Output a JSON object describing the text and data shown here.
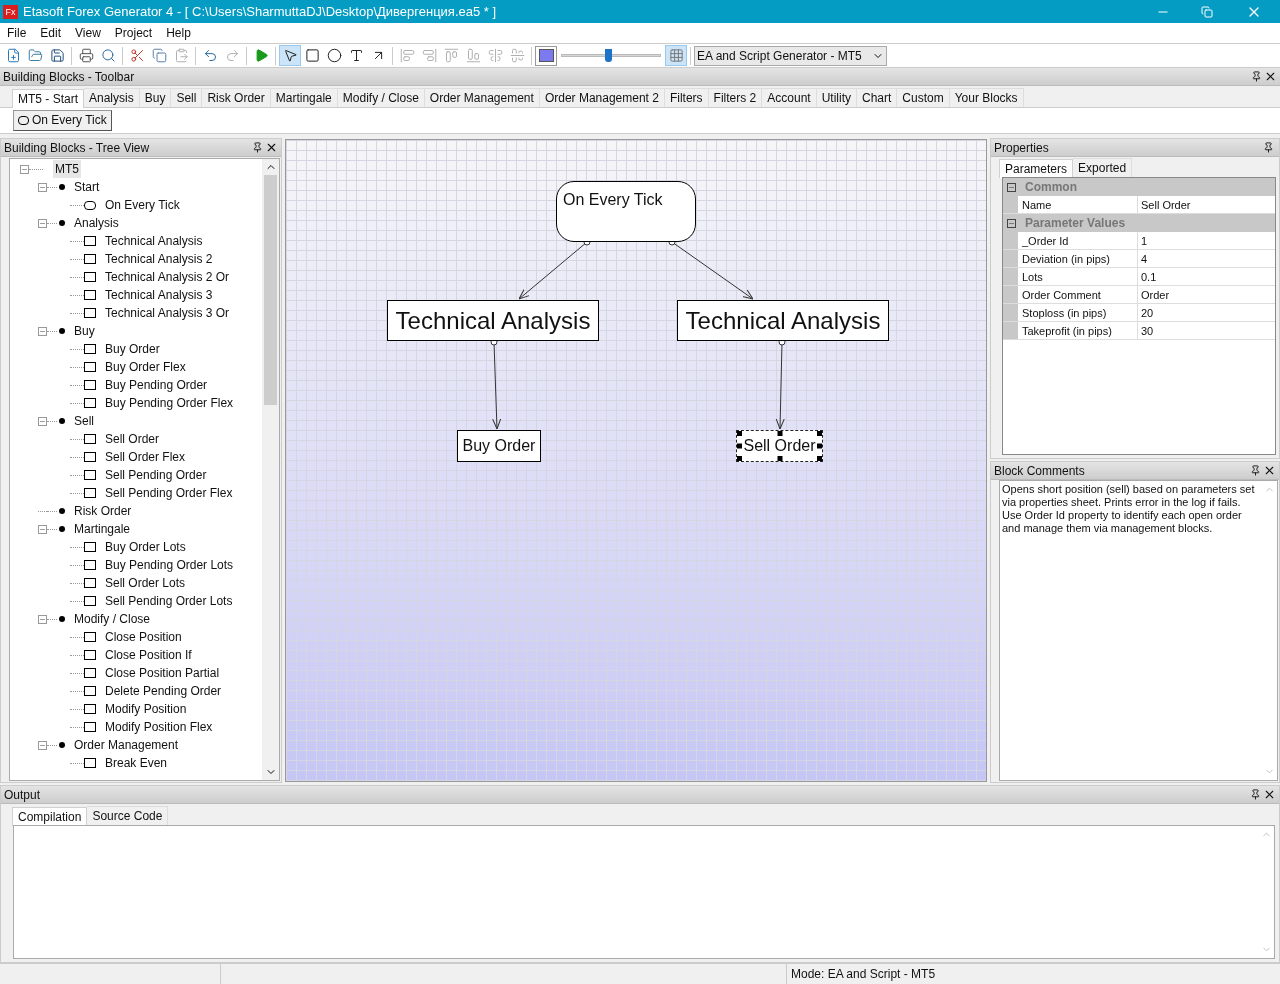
{
  "window": {
    "app_icon": "Fx",
    "title": "Etasoft Forex Generator 4 - [ C:\\Users\\SharmuttaDJ\\Desktop\\Дивергенция.ea5 * ]"
  },
  "menu": [
    "File",
    "Edit",
    "View",
    "Project",
    "Help"
  ],
  "toolbar": {
    "groups": [
      [
        {
          "kind": "new",
          "disabled": false
        },
        {
          "kind": "open",
          "disabled": false
        },
        {
          "kind": "save",
          "disabled": false
        }
      ],
      [
        {
          "kind": "print",
          "disabled": false
        },
        {
          "kind": "preview",
          "disabled": false
        }
      ],
      [
        {
          "kind": "cut",
          "disabled": false
        },
        {
          "kind": "copy",
          "disabled": false
        },
        {
          "kind": "paste",
          "disabled": true
        }
      ],
      [
        {
          "kind": "undo",
          "disabled": false
        },
        {
          "kind": "redo",
          "disabled": true
        }
      ],
      [
        {
          "kind": "run",
          "disabled": false
        }
      ],
      [
        {
          "kind": "pointer",
          "selected": true
        },
        {
          "kind": "rectangle",
          "selected": false
        },
        {
          "kind": "ellipse",
          "selected": false
        },
        {
          "kind": "text",
          "selected": false
        },
        {
          "kind": "connector",
          "selected": false
        }
      ],
      [
        {
          "kind": "align-left",
          "disabled": true
        },
        {
          "kind": "align-right",
          "disabled": true
        },
        {
          "kind": "align-top",
          "disabled": true
        },
        {
          "kind": "align-bottom",
          "disabled": true
        },
        {
          "kind": "align-middle",
          "disabled": true
        },
        {
          "kind": "align-center",
          "disabled": true
        }
      ],
      [
        {
          "kind": "color"
        },
        {
          "kind": "zoom",
          "level": 0.47
        },
        {
          "kind": "grid",
          "selected": true
        }
      ]
    ],
    "mode_select": "EA and Script Generator - MT5"
  },
  "blocks_toolbar": {
    "title": "Building Blocks - Toolbar",
    "tabs": [
      {
        "label": "MT5 - Start",
        "selected": true
      },
      {
        "label": "Analysis",
        "selected": false
      },
      {
        "label": "Buy",
        "selected": false
      },
      {
        "label": "Sell",
        "selected": false
      },
      {
        "label": "Risk Order",
        "selected": false
      },
      {
        "label": "Martingale",
        "selected": false
      },
      {
        "label": "Modify / Close",
        "selected": false
      },
      {
        "label": "Order Management",
        "selected": false
      },
      {
        "label": "Order Management 2",
        "selected": false
      },
      {
        "label": "Filters",
        "selected": false
      },
      {
        "label": "Filters 2",
        "selected": false
      },
      {
        "label": "Account",
        "selected": false
      },
      {
        "label": "Utility",
        "selected": false
      },
      {
        "label": "Chart",
        "selected": false
      },
      {
        "label": "Custom",
        "selected": false
      },
      {
        "label": "Your Blocks",
        "selected": false
      }
    ],
    "blocks": [
      "On Every Tick"
    ]
  },
  "tree": {
    "title": "Building Blocks - Tree View",
    "root": {
      "label": "MT5",
      "expanded": true,
      "selected": true,
      "children": [
        {
          "label": "Start",
          "expanded": true,
          "selected": false,
          "children": [
            {
              "label": "On Every Tick",
              "kind": "event",
              "selected": false
            }
          ]
        },
        {
          "label": "Analysis",
          "expanded": true,
          "selected": false,
          "children": [
            {
              "label": "Technical Analysis",
              "kind": "block",
              "selected": false
            },
            {
              "label": "Technical Analysis 2",
              "kind": "block",
              "selected": false
            },
            {
              "label": "Technical Analysis 2 Or",
              "kind": "block",
              "selected": false
            },
            {
              "label": "Technical Analysis 3",
              "kind": "block",
              "selected": false
            },
            {
              "label": "Technical Analysis 3 Or",
              "kind": "block",
              "selected": false
            }
          ]
        },
        {
          "label": "Buy",
          "expanded": true,
          "selected": false,
          "children": [
            {
              "label": "Buy Order",
              "kind": "block",
              "selected": false
            },
            {
              "label": "Buy Order Flex",
              "kind": "block",
              "selected": false
            },
            {
              "label": "Buy Pending Order",
              "kind": "block",
              "selected": false
            },
            {
              "label": "Buy Pending Order Flex",
              "kind": "block",
              "selected": false
            }
          ]
        },
        {
          "label": "Sell",
          "expanded": true,
          "selected": false,
          "children": [
            {
              "label": "Sell Order",
              "kind": "block",
              "selected": false
            },
            {
              "label": "Sell Order Flex",
              "kind": "block",
              "selected": false
            },
            {
              "label": "Sell Pending Order",
              "kind": "block",
              "selected": false
            },
            {
              "label": "Sell Pending Order Flex",
              "kind": "block",
              "selected": false
            }
          ]
        },
        {
          "label": "Risk Order",
          "selected": false
        },
        {
          "label": "Martingale",
          "expanded": true,
          "selected": false,
          "children": [
            {
              "label": "Buy Order Lots",
              "kind": "block",
              "selected": false
            },
            {
              "label": "Buy Pending Order Lots",
              "kind": "block",
              "selected": false
            },
            {
              "label": "Sell Order Lots",
              "kind": "block",
              "selected": false
            },
            {
              "label": "Sell Pending Order Lots",
              "kind": "block",
              "selected": false
            }
          ]
        },
        {
          "label": "Modify / Close",
          "expanded": true,
          "selected": false,
          "children": [
            {
              "label": "Close Position",
              "kind": "block",
              "selected": false
            },
            {
              "label": "Close Position If",
              "kind": "block",
              "selected": false
            },
            {
              "label": "Close Position Partial",
              "kind": "block",
              "selected": false
            },
            {
              "label": "Delete Pending Order",
              "kind": "block",
              "selected": false
            },
            {
              "label": "Modify Position",
              "kind": "block",
              "selected": false
            },
            {
              "label": "Modify Position Flex",
              "kind": "block",
              "selected": false
            }
          ]
        },
        {
          "label": "Order Management",
          "expanded": true,
          "selected": false,
          "children": [
            {
              "label": "Break Even",
              "kind": "block",
              "selected": false
            }
          ]
        }
      ]
    }
  },
  "diagram": {
    "nodes": [
      {
        "label": "On Every Tick",
        "kind": "event",
        "selected": false
      },
      {
        "label": "Technical Analysis",
        "kind": "block",
        "selected": false
      },
      {
        "label": "Technical Analysis",
        "kind": "block",
        "selected": false
      },
      {
        "label": "Buy Order",
        "kind": "block",
        "selected": false
      },
      {
        "label": "Sell Order",
        "kind": "block",
        "selected": true
      }
    ]
  },
  "properties": {
    "title": "Properties",
    "tabs": [
      {
        "label": "Parameters",
        "selected": true
      },
      {
        "label": "Exported",
        "selected": false
      }
    ],
    "categories": [
      {
        "label": "Common",
        "expanded": true,
        "rows": [
          {
            "name": "Name",
            "value": "Sell Order"
          }
        ]
      },
      {
        "label": "Parameter Values",
        "expanded": true,
        "rows": [
          {
            "name": "_Order Id",
            "value": "1"
          },
          {
            "name": "Deviation (in pips)",
            "value": "4"
          },
          {
            "name": "Lots",
            "value": "0.1"
          },
          {
            "name": "Order Comment",
            "value": "Order"
          },
          {
            "name": "Stoploss (in pips)",
            "value": "20"
          },
          {
            "name": "Takeprofit (in pips)",
            "value": "30"
          }
        ]
      }
    ]
  },
  "block_comments": {
    "title": "Block Comments",
    "text": "Opens short position (sell) based on parameters set via properties sheet. Prints error in the log if fails. Use Order Id property to identify each open order and manage them via management blocks."
  },
  "output": {
    "title": "Output",
    "tabs": [
      {
        "label": "Compilation",
        "selected": true
      },
      {
        "label": "Source Code",
        "selected": false
      }
    ]
  },
  "status_bar": {
    "mode": "Mode: EA and Script - MT5"
  }
}
